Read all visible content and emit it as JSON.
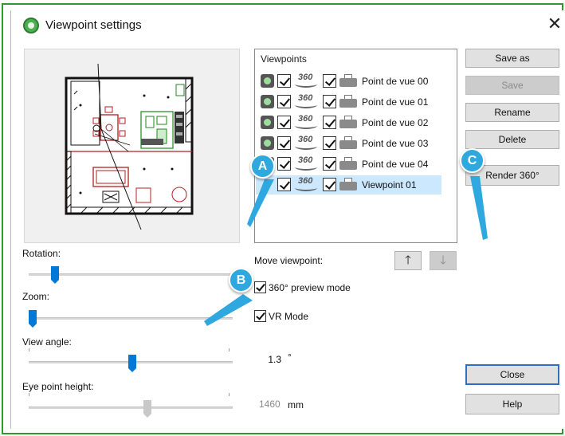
{
  "window": {
    "title": "Viewpoint settings",
    "close_glyph": "✕",
    "frame_color": "#2e9a2e"
  },
  "viewpoints": {
    "header": "Viewpoints",
    "rows": [
      {
        "label": "Point de vue 00",
        "selected": false
      },
      {
        "label": "Point de vue 01",
        "selected": false
      },
      {
        "label": "Point de vue 02",
        "selected": false
      },
      {
        "label": "Point de vue 03",
        "selected": false
      },
      {
        "label": "Point de vue 04",
        "selected": false
      },
      {
        "label": "Viewpoint 01",
        "selected": true
      }
    ],
    "icon_360_text": "360",
    "selected_color": "#cce8ff"
  },
  "buttons": {
    "save_as": "Save as",
    "save": "Save",
    "rename": "Rename",
    "delete": "Delete",
    "render_360": "Render 360°",
    "close": "Close",
    "help": "Help"
  },
  "move_viewpoint": {
    "label": "Move viewpoint:",
    "up_glyph": "🡑",
    "down_glyph": "🡓"
  },
  "options": {
    "preview_360": {
      "label": "360° preview mode",
      "checked": true
    },
    "vr_mode": {
      "label": "VR Mode",
      "checked": true
    }
  },
  "sliders": {
    "rotation": {
      "label": "Rotation:"
    },
    "zoom": {
      "label": "Zoom:"
    },
    "view_angle": {
      "label": "View angle:",
      "value": "1.3",
      "unit": "°"
    },
    "eye_point_height": {
      "label": "Eye point height:",
      "value": "1460",
      "unit": "mm"
    }
  },
  "annotations": {
    "a": "A",
    "b": "B",
    "c": "C",
    "color": "#2fa8e0"
  },
  "icons": {
    "app": "app-logo-icon",
    "camera": "camera-icon",
    "panorama": "panorama-360-icon",
    "printer": "printer-icon"
  },
  "accent_color": "#0078d7"
}
